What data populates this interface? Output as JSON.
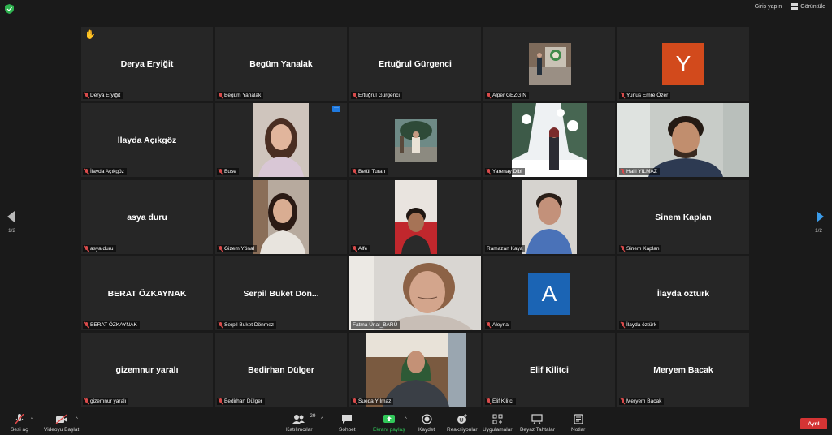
{
  "top_bar": {
    "sign_in": "Giriş yapın",
    "view": "Görüntüle"
  },
  "pagination": {
    "left": "1/2",
    "right": "1/2"
  },
  "participants": [
    {
      "display": "Derya Eryiğit",
      "label": "Derya Eryiğit",
      "raised_hand": true
    },
    {
      "display": "Begüm Yanalak",
      "label": "Begüm Yanalak"
    },
    {
      "display": "Ertuğrul Gürgenci",
      "label": "Ertuğrul Gürgenci"
    },
    {
      "display": "",
      "label": "Alper GEZGİN"
    },
    {
      "display": "Y",
      "label": "Yunus Emre Özer",
      "avatar_color": "#d24a1c"
    },
    {
      "display": "İlayda Açıkgöz",
      "label": "İlayda Açıkgöz"
    },
    {
      "display": "",
      "label": "Buse"
    },
    {
      "display": "",
      "label": "Betül Turan"
    },
    {
      "display": "",
      "label": "Yarenay Dibi"
    },
    {
      "display": "",
      "label": "Halil YILMAZ"
    },
    {
      "display": "asya duru",
      "label": "asya duru"
    },
    {
      "display": "",
      "label": "Gizem Yönal"
    },
    {
      "display": "",
      "label": "Alfe"
    },
    {
      "display": "",
      "label": "Ramazan Kaya"
    },
    {
      "display": "Sinem Kaplan",
      "label": "Sinem Kaplan"
    },
    {
      "display": "BERAT ÖZKAYNAK",
      "label": "BERAT ÖZKAYNAK"
    },
    {
      "display": "Serpil Buket Dön...",
      "label": "Serpil Buket Dönmez"
    },
    {
      "display": "",
      "label": "Fatma Ünal_BARÜ"
    },
    {
      "display": "A",
      "label": "Aleyna",
      "avatar_color": "#1b64b4"
    },
    {
      "display": "İlayda öztürk",
      "label": "İlayda öztürk"
    },
    {
      "display": "gizemnur yaralı",
      "label": "gizemnur yaralı"
    },
    {
      "display": "Bedirhan Dülger",
      "label": "Bedirhan Dülger"
    },
    {
      "display": "",
      "label": "Sueda Yılmaz"
    },
    {
      "display": "Elif Kilitci",
      "label": "Elif Kilitci"
    },
    {
      "display": "Meryem Bacak",
      "label": "Meryem Bacak"
    }
  ],
  "more_button": "···",
  "toolbar": {
    "audio": "Sesi aç",
    "video": "Videoyu Başlat",
    "participants": "Katılımcılar",
    "participants_count": "29",
    "chat": "Sohbet",
    "share": "Ekranı paylaş",
    "record": "Kaydet",
    "reactions": "Reaksiyonlar",
    "apps": "Uygulamalar",
    "whiteboard": "Beyaz Tahtalar",
    "notes": "Notlar",
    "leave": "Ayrıl"
  }
}
